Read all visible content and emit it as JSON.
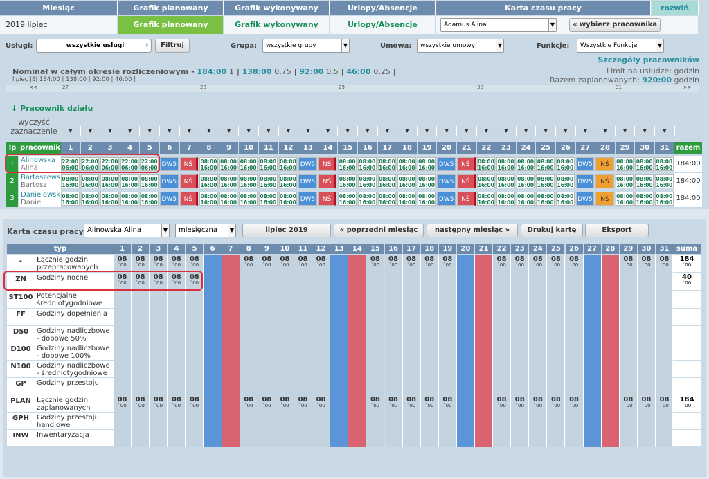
{
  "nav": {
    "headers": [
      "Miesiąc",
      "Grafik planowany",
      "Grafik wykonywany",
      "Urlopy/Absencje",
      "Karta czasu pracy"
    ],
    "expand": "rozwiń",
    "period": "2019 lipiec",
    "tabs": [
      "Grafik planowany",
      "Grafik wykonywany",
      "Urlopy/Absencje"
    ],
    "employee_select": "Adamus Alina",
    "choose_employee": "« wybierz pracownika"
  },
  "filters": {
    "uslugi_label": "Usługi:",
    "uslugi_value": "wszystkie usługi",
    "filter_btn": "Filtruj",
    "grupa_label": "Grupa:",
    "grupa_value": "wszystkie grupy",
    "umowa_label": "Umowa:",
    "umowa_value": "wszystkie umowy",
    "funkcje_label": "Funkcje:",
    "funkcje_value": "Wszystkie Funkcje"
  },
  "nominal": {
    "details_link": "Szczegóły pracowników",
    "text": "Nominał w całym okresie rozliczeniowym -",
    "values": [
      {
        "h": "184:00",
        "f": "1"
      },
      {
        "h": "138:00",
        "f": "0,75"
      },
      {
        "h": "92:00",
        "f": "0,5"
      },
      {
        "h": "46:00",
        "f": "0,25"
      }
    ],
    "month_line": "lipiec |8| 184:00 | 138:00 | 92:00 | 46:00 |",
    "limit_label": "Limit na usłudze:",
    "limit_value": "godzin",
    "planned_label": "Razem zaplanowanych:",
    "planned_value": "920:00",
    "planned_unit": "godzin"
  },
  "week_nav": {
    "prev": "<<",
    "next": ">>",
    "weeks": [
      "27",
      "28",
      "29",
      "30",
      "31"
    ]
  },
  "section_title": "↓ Pracownik działu",
  "clear_selection": "wyczyść zaznaczenie",
  "grid": {
    "lp": "lp",
    "employee_col": "pracownik",
    "total_col": "razem",
    "employees": [
      {
        "lp": "1",
        "last": "Alinowska",
        "first": "Alina",
        "total": "184:00",
        "night": true
      },
      {
        "lp": "2",
        "last": "Bartoszewsk",
        "first": "Bartosz",
        "total": "184:00",
        "night": false
      },
      {
        "lp": "3",
        "last": "Danielowski",
        "first": "Daniel",
        "total": "184:00",
        "night": false
      }
    ],
    "day_shift": [
      "08:00",
      "16:00"
    ],
    "night_shift": [
      "22:00",
      "06:00"
    ],
    "dw5": "DW5",
    "ns": "NŚ"
  },
  "card": {
    "label": "Karta czasu pracy:",
    "employee": "Alinowska Alina",
    "mode": "miesięczna",
    "month_btn": "lipiec 2019",
    "prev_btn": "« poprzedni miesiąc",
    "next_btn": "następny miesiąc »",
    "print_btn": "Drukuj kartę",
    "export_btn": "Eksport",
    "type_col": "typ",
    "sum_col": "suma",
    "rows": [
      {
        "code": "-",
        "name": "Łącznie godzin przepracowanych",
        "kind": "all",
        "sum": "184",
        "sum2": "`00"
      },
      {
        "code": "ZN",
        "name": "Godziny nocne",
        "kind": "night",
        "sum": "40",
        "sum2": "`00"
      },
      {
        "code": "ST100",
        "name": "Potencjalne średniotygodniowe",
        "kind": "none",
        "sum": "",
        "sum2": ""
      },
      {
        "code": "FF",
        "name": "Godziny dopełnienia",
        "kind": "none",
        "sum": "",
        "sum2": ""
      },
      {
        "code": "D50",
        "name": "Godziny nadliczbowe - dobowe 50%",
        "kind": "none",
        "sum": "",
        "sum2": ""
      },
      {
        "code": "D100",
        "name": "Godziny nadliczbowe - dobowe 100%",
        "kind": "none",
        "sum": "",
        "sum2": ""
      },
      {
        "code": "N100",
        "name": "Godziny nadliczbowe - średniotygodniowe",
        "kind": "none",
        "sum": "",
        "sum2": ""
      },
      {
        "code": "GP",
        "name": "Godziny przestoju",
        "kind": "none",
        "sum": "",
        "sum2": ""
      },
      {
        "code": "PLAN",
        "name": "Łącznie godzin zaplanowanych",
        "kind": "all",
        "sum": "184",
        "sum2": "`00"
      },
      {
        "code": "GPH",
        "name": "Godziny przestoju handlowe",
        "kind": "none",
        "sum": "",
        "sum2": ""
      },
      {
        "code": "INW",
        "name": "Inwentaryzacja",
        "kind": "none",
        "sum": "",
        "sum2": ""
      }
    ],
    "cell_value": "08",
    "cell_minutes": "`00"
  },
  "days": [
    "1",
    "2",
    "3",
    "4",
    "5",
    "6",
    "7",
    "8",
    "9",
    "10",
    "11",
    "12",
    "13",
    "14",
    "15",
    "16",
    "17",
    "18",
    "19",
    "20",
    "21",
    "22",
    "23",
    "24",
    "25",
    "26",
    "27",
    "28",
    "29",
    "30",
    "31"
  ],
  "colors": {
    "nav": "#6d8cad",
    "green": "#2e9b3e",
    "saturday": "#5b95d8",
    "sunday": "#da6372",
    "highlight": "#d9303b"
  }
}
